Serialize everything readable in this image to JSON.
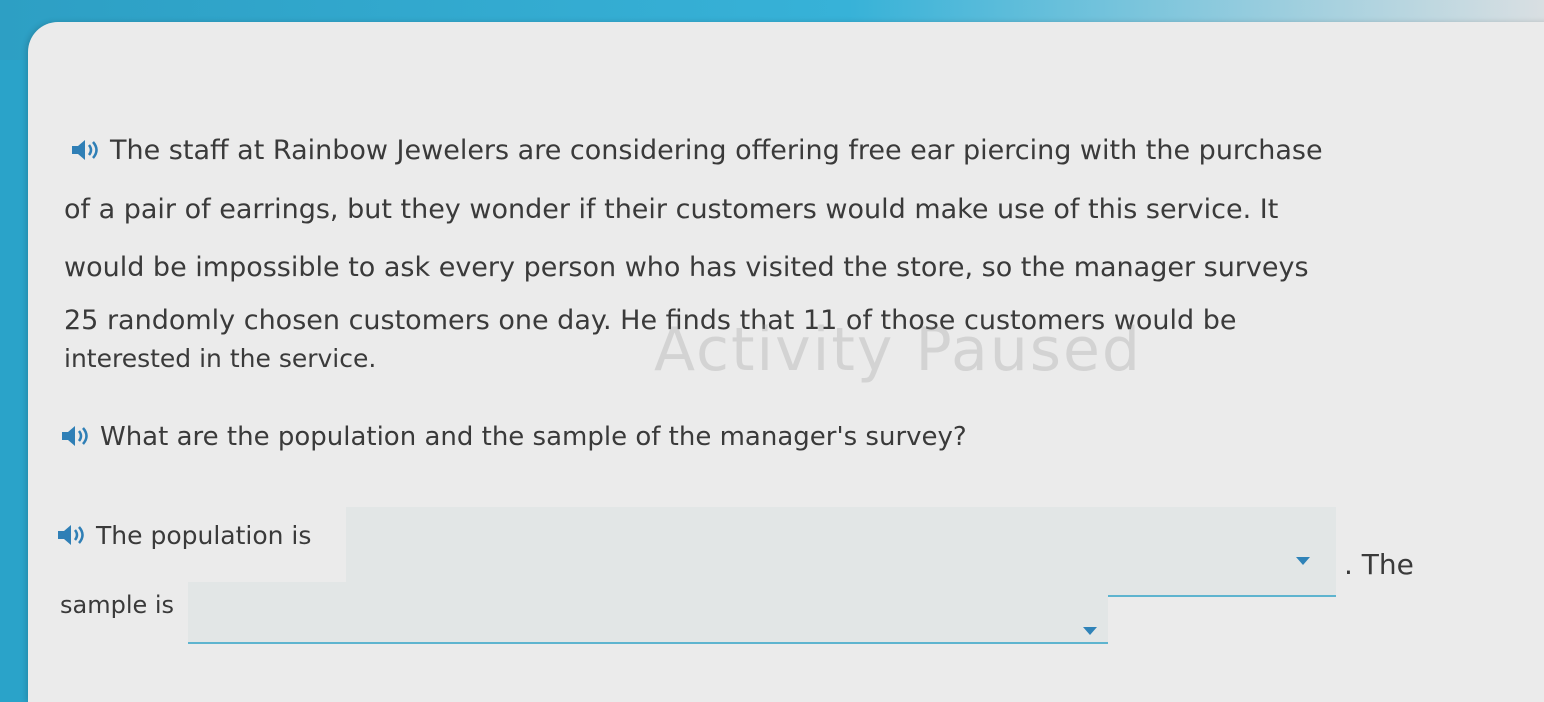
{
  "problem": {
    "lines": [
      "The staff at Rainbow Jewelers are considering offering free ear piercing with the purchase",
      "of a pair of earrings, but they wonder if their customers would make use of this service. It",
      "would be impossible to ask every person who has visited the store, so the manager surveys",
      "25 randomly chosen customers one day. He finds that 11 of those customers would be",
      "interested in the service."
    ]
  },
  "question": "What are the population and the sample of the manager's survey?",
  "answer": {
    "population_prefix": "The population is",
    "population_value": "",
    "mid_text": ". The",
    "sample_prefix": "sample is",
    "sample_value": ""
  },
  "watermark": "Activity Paused",
  "colors": {
    "accent": "#2aa3c9",
    "dropdown_caret": "#2f83b8",
    "card": "#ebebeb"
  },
  "icons": [
    "speaker-icon",
    "chevron-down-icon"
  ]
}
